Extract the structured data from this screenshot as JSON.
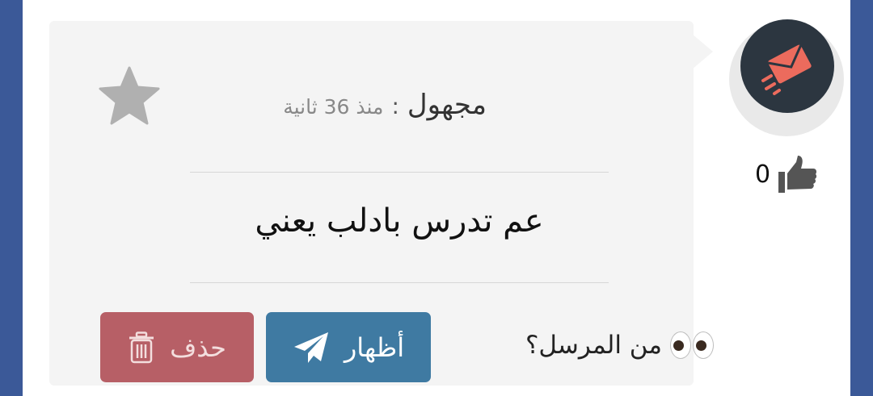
{
  "post": {
    "sender_name": "مجهول",
    "separator": ":",
    "timestamp": "منذ 36 ثانية",
    "message": "عم تدرس بادلب يعني",
    "who_sent_label": "من المرسل؟",
    "likes": "0"
  },
  "actions": {
    "show_label": "أظهار",
    "delete_label": "حذف"
  },
  "icons": {
    "avatar": "envelope-send-icon",
    "like": "thumbs-up-icon",
    "favorite": "star-icon",
    "show": "paper-plane-icon",
    "delete": "trash-icon",
    "who": "eyes-emoji"
  },
  "colors": {
    "page_background": "#3b5998",
    "show_button": "#3f7aa2",
    "delete_button": "#b75f66",
    "avatar_background": "#2c3640",
    "avatar_accent": "#ec6b5d"
  }
}
